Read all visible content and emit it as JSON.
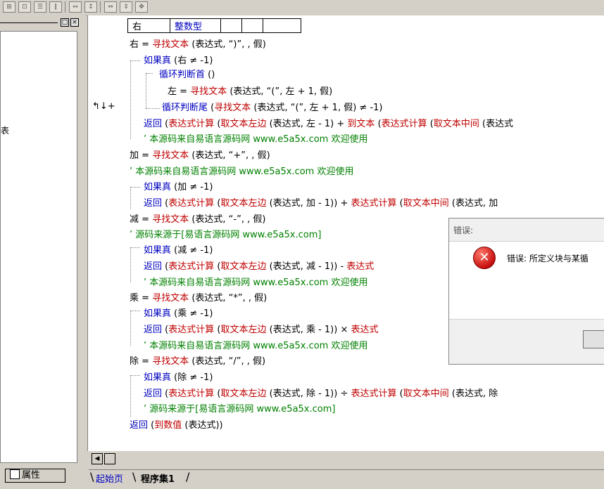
{
  "toolbar": {
    "icons": [
      "table-icon",
      "split-icon",
      "grid-icon",
      "columns-icon",
      "stretch-h-icon",
      "stretch-v-icon",
      "width-icon",
      "height-icon",
      "size-icon"
    ]
  },
  "left_panel": {
    "tree_partial_text": "表",
    "tab_label": "属性"
  },
  "margin": {
    "marker": "↰↓+"
  },
  "var_table": {
    "name": "右",
    "type": "整数型"
  },
  "code": {
    "l1": {
      "var": "右",
      "op": " = ",
      "fn": "寻找文本",
      "args": " (表达式, “)”, , 假)"
    },
    "l2": {
      "kw": "如果真",
      "args": " (右 ≠ -1)"
    },
    "l3": {
      "kw": "循环判断首",
      "args": " ()"
    },
    "l4": {
      "var": "左",
      "op": " = ",
      "fn": "寻找文本",
      "args": " (表达式, “(”, 左 + 1, 假)"
    },
    "l5": {
      "kw": "循环判断尾",
      "args_a": " (",
      "fn": "寻找文本",
      "args_b": " (表达式, “(”, 左 + 1, 假) ≠ -1)"
    },
    "l6": {
      "kw": "返回",
      "args_a": " (",
      "fn1": "表达式计算",
      "args_b": " (",
      "fn2": "取文本左边",
      "args_c": " (表达式, 左 - 1) + ",
      "fn3": "到文本",
      "args_d": " (",
      "fn4": "表达式计算",
      "args_e": " (",
      "fn5": "取文本中间",
      "args_f": " (表达式"
    },
    "l7": {
      "comment": "’ 本源码来自易语言源码网 www.e5a5x.com  欢迎使用"
    },
    "l8": {
      "var": "加",
      "op": " = ",
      "fn": "寻找文本",
      "args": " (表达式, “+”, , 假)"
    },
    "l9": {
      "comment": "’ 本源码来自易语言源码网 www.e5a5x.com  欢迎使用"
    },
    "l10": {
      "kw": "如果真",
      "args": " (加 ≠ -1)"
    },
    "l11": {
      "kw": "返回",
      "args_a": " (",
      "fn1": "表达式计算",
      "args_b": " (",
      "fn2": "取文本左边",
      "args_c": " (表达式, 加 - 1)) + ",
      "fn3": "表达式计算",
      "args_d": " (",
      "fn4": "取文本中间",
      "args_e": " (表达式, 加"
    },
    "l12": {
      "var": "减",
      "op": " = ",
      "fn": "寻找文本",
      "args": " (表达式, “-”, , 假)"
    },
    "l13": {
      "comment": "’ 源码来源于[易语言源码网 www.e5a5x.com]"
    },
    "l14": {
      "kw": "如果真",
      "args": " (减 ≠ -1)"
    },
    "l15": {
      "kw": "返回",
      "args_a": " (",
      "fn1": "表达式计算",
      "args_b": " (",
      "fn2": "取文本左边",
      "args_c": " (表达式, 减 - 1)) - ",
      "fn3": "表达式"
    },
    "l16": {
      "comment": "’ 本源码来自易语言源码网 www.e5a5x.com  欢迎使用"
    },
    "l17": {
      "var": "乘",
      "op": " = ",
      "fn": "寻找文本",
      "args": " (表达式, “*”, , 假)"
    },
    "l18": {
      "kw": "如果真",
      "args": " (乘 ≠ -1)"
    },
    "l19": {
      "kw": "返回",
      "args_a": " (",
      "fn1": "表达式计算",
      "args_b": " (",
      "fn2": "取文本左边",
      "args_c": " (表达式, 乘 - 1)) × ",
      "fn3": "表达式"
    },
    "l20": {
      "comment": "’ 本源码来自易语言源码网 www.e5a5x.com  欢迎使用"
    },
    "l21": {
      "var": "除",
      "op": " = ",
      "fn": "寻找文本",
      "args": " (表达式, “/”, , 假)"
    },
    "l22": {
      "kw": "如果真",
      "args": " (除 ≠ -1)"
    },
    "l23": {
      "kw": "返回",
      "args_a": " (",
      "fn1": "表达式计算",
      "args_b": " (",
      "fn2": "取文本左边",
      "args_c": " (表达式, 除 - 1)) ÷ ",
      "fn3": "表达式计算",
      "args_d": " (",
      "fn4": "取文本中间",
      "args_e": " (表达式, 除"
    },
    "l24": {
      "comment": "’ 源码来源于[易语言源码网 www.e5a5x.com]"
    },
    "l25": {
      "kw": "返回",
      "args_a": " (",
      "fn": "到数值",
      "args_b": " (表达式))"
    }
  },
  "tabs": {
    "start": "起始页",
    "active": "程序集1"
  },
  "dialog": {
    "title": "错误:",
    "message": "错误: 所定义块与某循",
    "icon": "error-icon"
  },
  "colors": {
    "keyword": "#0000c0",
    "function": "#c00000",
    "comment": "#008000",
    "text": "#000000"
  }
}
